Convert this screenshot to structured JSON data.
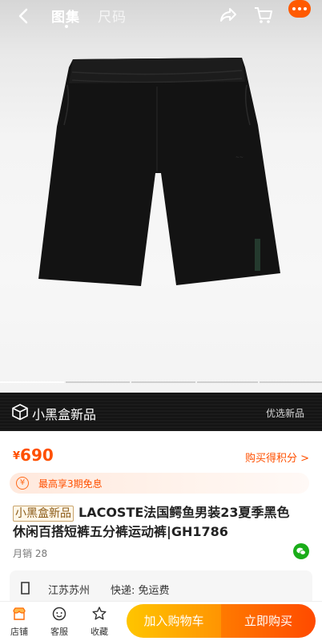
{
  "header": {
    "tabs": [
      {
        "label": "图集"
      },
      {
        "label": "尺码"
      }
    ]
  },
  "gallery": {
    "image_count": 5,
    "active_index": 0
  },
  "banner": {
    "title": "小黑盒新品",
    "right": "优选新品"
  },
  "product": {
    "currency": "¥",
    "price": "690",
    "points_link": "购买得积分 >",
    "installment": "最高享3期免息",
    "badge": "小黑盒新品",
    "title": "LACOSTE法国鳄鱼男装23夏季黑色休闲百搭短裤五分裤运动裤|GH1786",
    "monthly_sales": "月销 28"
  },
  "shipping": {
    "origin": "江苏苏州",
    "fee": "快递: 免运费"
  },
  "bottom_bar": {
    "store": "店铺",
    "service": "客服",
    "favorite": "收藏",
    "add_to_cart": "加入购物车",
    "buy_now": "立即购买"
  },
  "colors": {
    "accent": "#ff5000",
    "cart_button": "#ffb000",
    "buy_button": "#ff5a00",
    "banner_bg": "#171717"
  },
  "icons": [
    "back-icon",
    "share-icon",
    "cart-icon",
    "more-icon",
    "yen-icon",
    "wechat-icon",
    "location-icon",
    "store-icon",
    "service-icon",
    "star-icon"
  ]
}
